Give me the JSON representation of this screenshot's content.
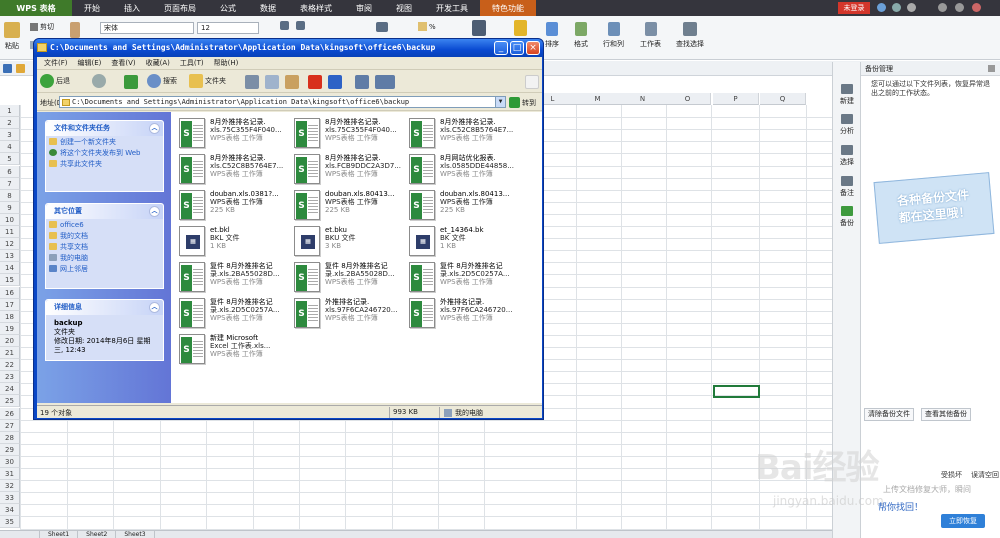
{
  "app": {
    "logo": "WPS 表格",
    "tabs": [
      "开始",
      "插入",
      "页面布局",
      "公式",
      "数据",
      "表格样式",
      "审阅",
      "视图",
      "开发工具",
      "特色功能"
    ],
    "login": "未登录"
  },
  "ribbon": {
    "paste": "粘贴",
    "cut": "剪切",
    "copy": "复制",
    "font_name": "宋体",
    "font_size": "12",
    "sort": "排序",
    "format": "格式",
    "row_col": "行和列",
    "sheet": "工作表",
    "find": "查找选择",
    "percent": "%"
  },
  "sheet": {
    "columns": [
      "L",
      "M",
      "N",
      "O",
      "P",
      "Q"
    ],
    "rows": [
      "1",
      "2",
      "3",
      "4",
      "5",
      "6",
      "7",
      "8",
      "9",
      "10",
      "11",
      "12",
      "13",
      "14",
      "15",
      "16",
      "17",
      "18",
      "19",
      "20",
      "21",
      "22",
      "23",
      "24",
      "25",
      "26",
      "27",
      "28",
      "29",
      "30",
      "31",
      "32",
      "33",
      "34",
      "35"
    ],
    "tabs": [
      "Sheet1",
      "Sheet2",
      "Sheet3"
    ]
  },
  "sidebar": {
    "items": [
      {
        "label": "新建",
        "icon": "new-icon"
      },
      {
        "label": "分析",
        "icon": "analyze-icon"
      },
      {
        "label": "选择",
        "icon": "select-icon"
      },
      {
        "label": "备注",
        "icon": "note-icon"
      },
      {
        "label": "备份",
        "icon": "backup-icon"
      }
    ]
  },
  "backup": {
    "title": "备份管理",
    "desc": "您可以通过以下文件列表，恢复异常退出之前的工作状态。",
    "promo_line1": "各种备份文件",
    "promo_line2": "都在这里哦！",
    "clear_btn": "清除备份文件",
    "view_btn": "查看其他备份",
    "bottom_left": "受损坏",
    "bottom_right": "误清空回",
    "help": "帮你找回！",
    "restore": "立即恢复",
    "promo_text": "上传文档修复大师，瞬间"
  },
  "explorer": {
    "title": "C:\\Documents and Settings\\Administrator\\Application Data\\kingsoft\\office6\\backup",
    "menus": [
      "文件(F)",
      "编辑(E)",
      "查看(V)",
      "收藏(A)",
      "工具(T)",
      "帮助(H)"
    ],
    "back": "后退",
    "search": "搜索",
    "folders": "文件夹",
    "address_label": "地址(D)",
    "address": "C:\\Documents and Settings\\Administrator\\Application Data\\kingsoft\\office6\\backup",
    "go": "转到",
    "tasks_title": "文件和文件夹任务",
    "tasks": [
      "创建一个新文件夹",
      "将这个文件夹发布到 Web",
      "共享此文件夹"
    ],
    "other_title": "其它位置",
    "other": [
      "office6",
      "我的文档",
      "共享文档",
      "我的电脑",
      "网上邻居"
    ],
    "details_title": "详细信息",
    "details_name": "backup",
    "details_type": "文件夹",
    "details_date": "修改日期: 2014年8月6日 星期三, 12:43",
    "status_count": "19 个对象",
    "status_size": "993 KB",
    "status_loc": "我的电脑",
    "files": [
      {
        "l1": "8月外推排名记录.",
        "l2": "xls.75C355F4F040...",
        "l3": "WPS表格 工作簿",
        "kind": "s"
      },
      {
        "l1": "8月外推排名记录.",
        "l2": "xls.75C355F4F040...",
        "l3": "WPS表格 工作簿",
        "kind": "s"
      },
      {
        "l1": "8月外推排名记录.",
        "l2": "xls.C52C8B5764E7...",
        "l3": "WPS表格 工作簿",
        "kind": "s"
      },
      {
        "l1": "8月外推排名记录.",
        "l2": "xls.C52C8B5764E7...",
        "l3": "WPS表格 工作簿",
        "kind": "s"
      },
      {
        "l1": "8月外推排名记录.",
        "l2": "xls.FCB9DDC2A3D7...",
        "l3": "WPS表格 工作簿",
        "kind": "s"
      },
      {
        "l1": "8月网站优化报表.",
        "l2": "xls.0585DDE44858...",
        "l3": "WPS表格 工作簿",
        "kind": "s"
      },
      {
        "l1": "douban.xls.0381?...",
        "l2": "WPS表格 工作簿",
        "l3": "225 KB",
        "kind": "s"
      },
      {
        "l1": "douban.xls.80413...",
        "l2": "WPS表格 工作簿",
        "l3": "225 KB",
        "kind": "s"
      },
      {
        "l1": "douban.xls.80413...",
        "l2": "WPS表格 工作簿",
        "l3": "225 KB",
        "kind": "s"
      },
      {
        "l1": "et.bkl",
        "l2": "BKL 文件",
        "l3": "1 KB",
        "kind": "bk"
      },
      {
        "l1": "et.bku",
        "l2": "BKU 文件",
        "l3": "3 KB",
        "kind": "bk"
      },
      {
        "l1": "et_14364.bk",
        "l2": "BK 文件",
        "l3": "1 KB",
        "kind": "bk"
      },
      {
        "l1": "复件 8月外推排名记",
        "l2": "录.xls.2BA55028D...",
        "l3": "WPS表格 工作簿",
        "kind": "s"
      },
      {
        "l1": "复件 8月外推排名记",
        "l2": "录.xls.2BA55028D...",
        "l3": "WPS表格 工作簿",
        "kind": "s"
      },
      {
        "l1": "复件 8月外推排名记",
        "l2": "录.xls.2D5C0257A...",
        "l3": "WPS表格 工作簿",
        "kind": "s"
      },
      {
        "l1": "复件 8月外推排名记",
        "l2": "录.xls.2D5C0257A...",
        "l3": "WPS表格 工作簿",
        "kind": "s"
      },
      {
        "l1": "外推排名记录.",
        "l2": "xls.97F6CA246720...",
        "l3": "WPS表格 工作簿",
        "kind": "s"
      },
      {
        "l1": "外推排名记录.",
        "l2": "xls.97F6CA246720...",
        "l3": "WPS表格 工作簿",
        "kind": "s"
      },
      {
        "l1": "新建 Microsoft",
        "l2": "Excel 工作表.xls...",
        "l3": "WPS表格 工作簿",
        "kind": "s"
      }
    ]
  },
  "watermark": {
    "text": "Bai经验",
    "sub": "jingyan.baidu.com"
  },
  "colors": {
    "accent": "#0a47c6",
    "wps_green": "#3f7a2a",
    "selection": "#207a3a"
  }
}
